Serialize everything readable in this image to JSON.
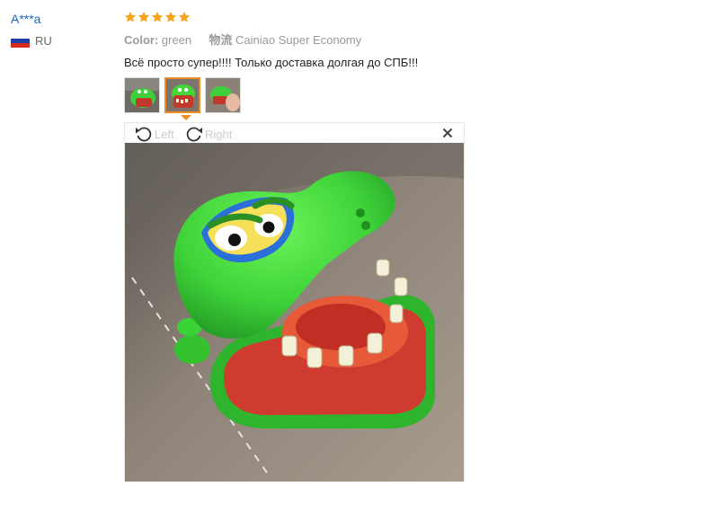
{
  "user": {
    "name": "A***a",
    "country": "RU"
  },
  "review": {
    "rating": 5,
    "color_label": "Color:",
    "color_value": "green",
    "shipping_label": "物流",
    "shipping_value": "Cainiao Super Economy",
    "text": "Всё просто супер!!!! Только доставка долгая до СПБ!!!"
  },
  "viewer": {
    "rotate_left_label": "Left",
    "rotate_right_label": "Right"
  },
  "colors": {
    "link": "#1967c8",
    "star": "#f7a21b",
    "accent": "#f08a24"
  },
  "thumbnails": {
    "count": 3,
    "selected_index": 1
  }
}
